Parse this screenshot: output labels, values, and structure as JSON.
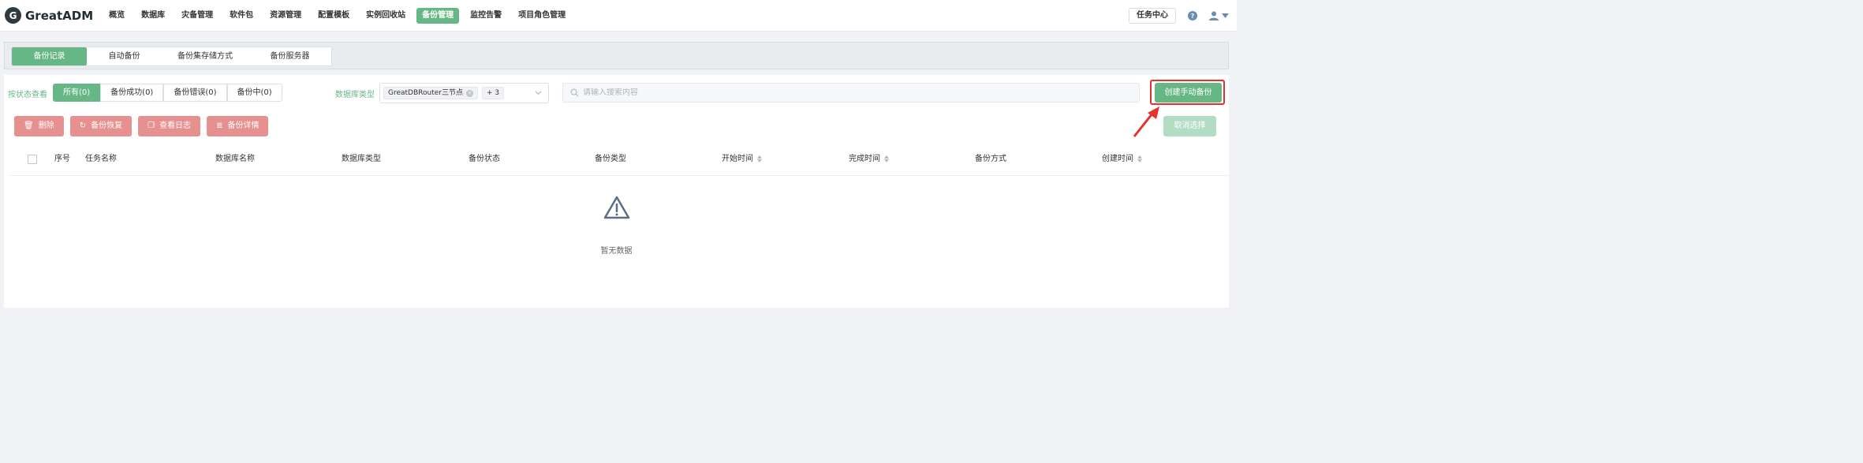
{
  "app": {
    "logo_letter": "G",
    "name": "GreatADM"
  },
  "nav": {
    "items": [
      {
        "label": "概览",
        "active": false
      },
      {
        "label": "数据库",
        "active": false
      },
      {
        "label": "灾备管理",
        "active": false
      },
      {
        "label": "软件包",
        "active": false
      },
      {
        "label": "资源管理",
        "active": false
      },
      {
        "label": "配置模板",
        "active": false
      },
      {
        "label": "实例回收站",
        "active": false
      },
      {
        "label": "备份管理",
        "active": true
      },
      {
        "label": "监控告警",
        "active": false
      },
      {
        "label": "项目角色管理",
        "active": false
      }
    ],
    "task_center": "任务中心",
    "help_icon": "question-icon",
    "user_icon": "user-icon"
  },
  "tabs": [
    {
      "label": "备份记录",
      "active": true
    },
    {
      "label": "自动备份",
      "active": false
    },
    {
      "label": "备份集存储方式",
      "active": false
    },
    {
      "label": "备份服务器",
      "active": false
    }
  ],
  "filters": {
    "status_label": "按状态查看",
    "status_options": [
      {
        "label": "所有(0)",
        "active": true
      },
      {
        "label": "备份成功(0)",
        "active": false
      },
      {
        "label": "备份错误(0)",
        "active": false
      },
      {
        "label": "备份中(0)",
        "active": false
      }
    ],
    "db_type_label": "数据库类型",
    "db_type_tag": "GreatDBRouter三节点",
    "db_type_more": "+ 3",
    "search_placeholder": "请输入搜索内容"
  },
  "actions": {
    "create_manual_backup": "创建手动备份",
    "delete": "删除",
    "restore": "备份恢复",
    "view_log": "查看日志",
    "details": "备份详情",
    "cancel_selection": "取消选择"
  },
  "table": {
    "columns": [
      {
        "label": "序号",
        "sortable": false
      },
      {
        "label": "任务名称",
        "sortable": false
      },
      {
        "label": "数据库名称",
        "sortable": false
      },
      {
        "label": "数据库类型",
        "sortable": false
      },
      {
        "label": "备份状态",
        "sortable": false
      },
      {
        "label": "备份类型",
        "sortable": false
      },
      {
        "label": "开始时间",
        "sortable": true
      },
      {
        "label": "完成时间",
        "sortable": true
      },
      {
        "label": "备份方式",
        "sortable": false
      },
      {
        "label": "创建时间",
        "sortable": true
      }
    ],
    "rows": [],
    "empty_text": "暂无数据"
  },
  "colors": {
    "accent": "#67b685",
    "danger_soft": "#e6908f",
    "annotation": "#e5302b"
  }
}
